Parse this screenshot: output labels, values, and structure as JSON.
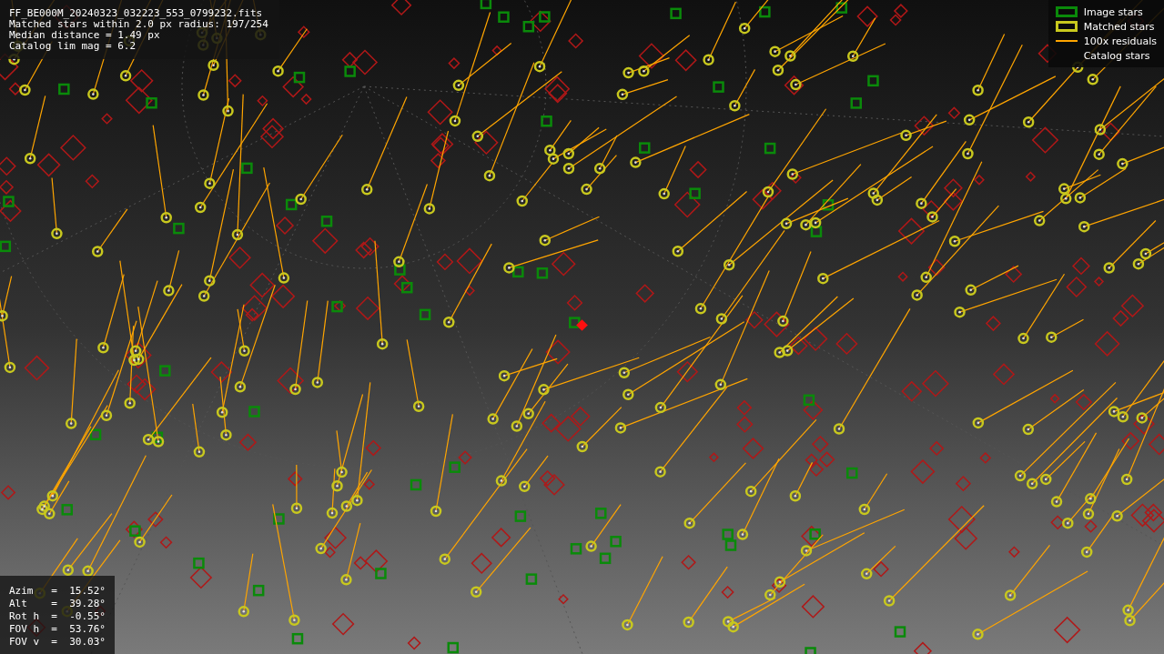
{
  "info_lines": [
    "FF_BE000M_20240323_032223_553_0799232.fits",
    "Matched stars within 2.0 px radius: 197/254",
    "Median distance = 1.49 px",
    "Catalog lim mag = 6.2"
  ],
  "legend": [
    {
      "kind": "rect",
      "color": "#0a8a0a",
      "label": "Image stars"
    },
    {
      "kind": "rect",
      "color": "#c8c81e",
      "label": "Matched stars"
    },
    {
      "kind": "line",
      "color": "#ffa500",
      "label": "100x residuals"
    },
    {
      "kind": "blank",
      "label": "Catalog stars"
    }
  ],
  "params": [
    "Azim   =  15.52°",
    "Alt    =  39.28°",
    "Rot h  =  -0.55°",
    "FOV h  =  53.76°",
    "FOV v  =  30.03°"
  ]
}
